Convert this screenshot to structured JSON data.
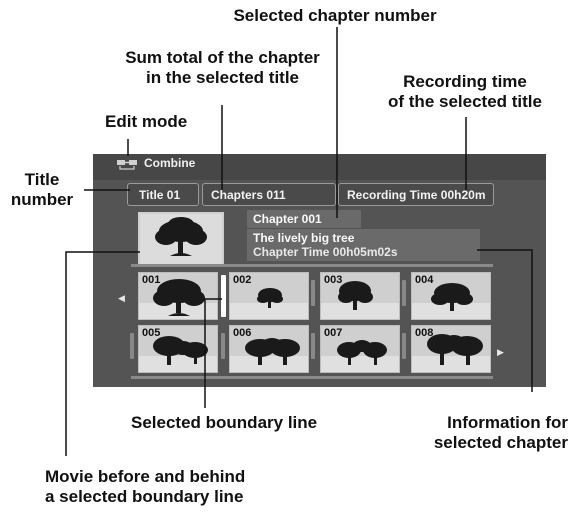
{
  "screen": {
    "mode_label": "Combine",
    "icon": "edit-mode-icon",
    "title_box": "Title 01",
    "chapters_box": "Chapters 011",
    "recording_time_box": "Recording Time  00h20m",
    "selected_chapter": "Chapter 001",
    "chapter_name": "The lively big tree",
    "chapter_time": "Chapter Time  00h05m02s",
    "thumbnails": [
      "001",
      "002",
      "003",
      "004",
      "005",
      "006",
      "007",
      "008"
    ],
    "left_arrow": "◀",
    "right_arrow": "▶"
  },
  "callouts": {
    "selected_chapter_number": "Selected chapter number",
    "sum_total_line1": "Sum total of the chapter",
    "sum_total_line2": "in the selected title",
    "recording_time_line1": "Recording time",
    "recording_time_line2": "of the selected title",
    "edit_mode": "Edit mode",
    "title_number_line1": "Title",
    "title_number_line2": "number",
    "selected_boundary_line": "Selected boundary line",
    "info_line1": "Information for",
    "info_line2": "selected chapter",
    "movie_line1": "Movie before and behind",
    "movie_line2": "a selected boundary line"
  }
}
